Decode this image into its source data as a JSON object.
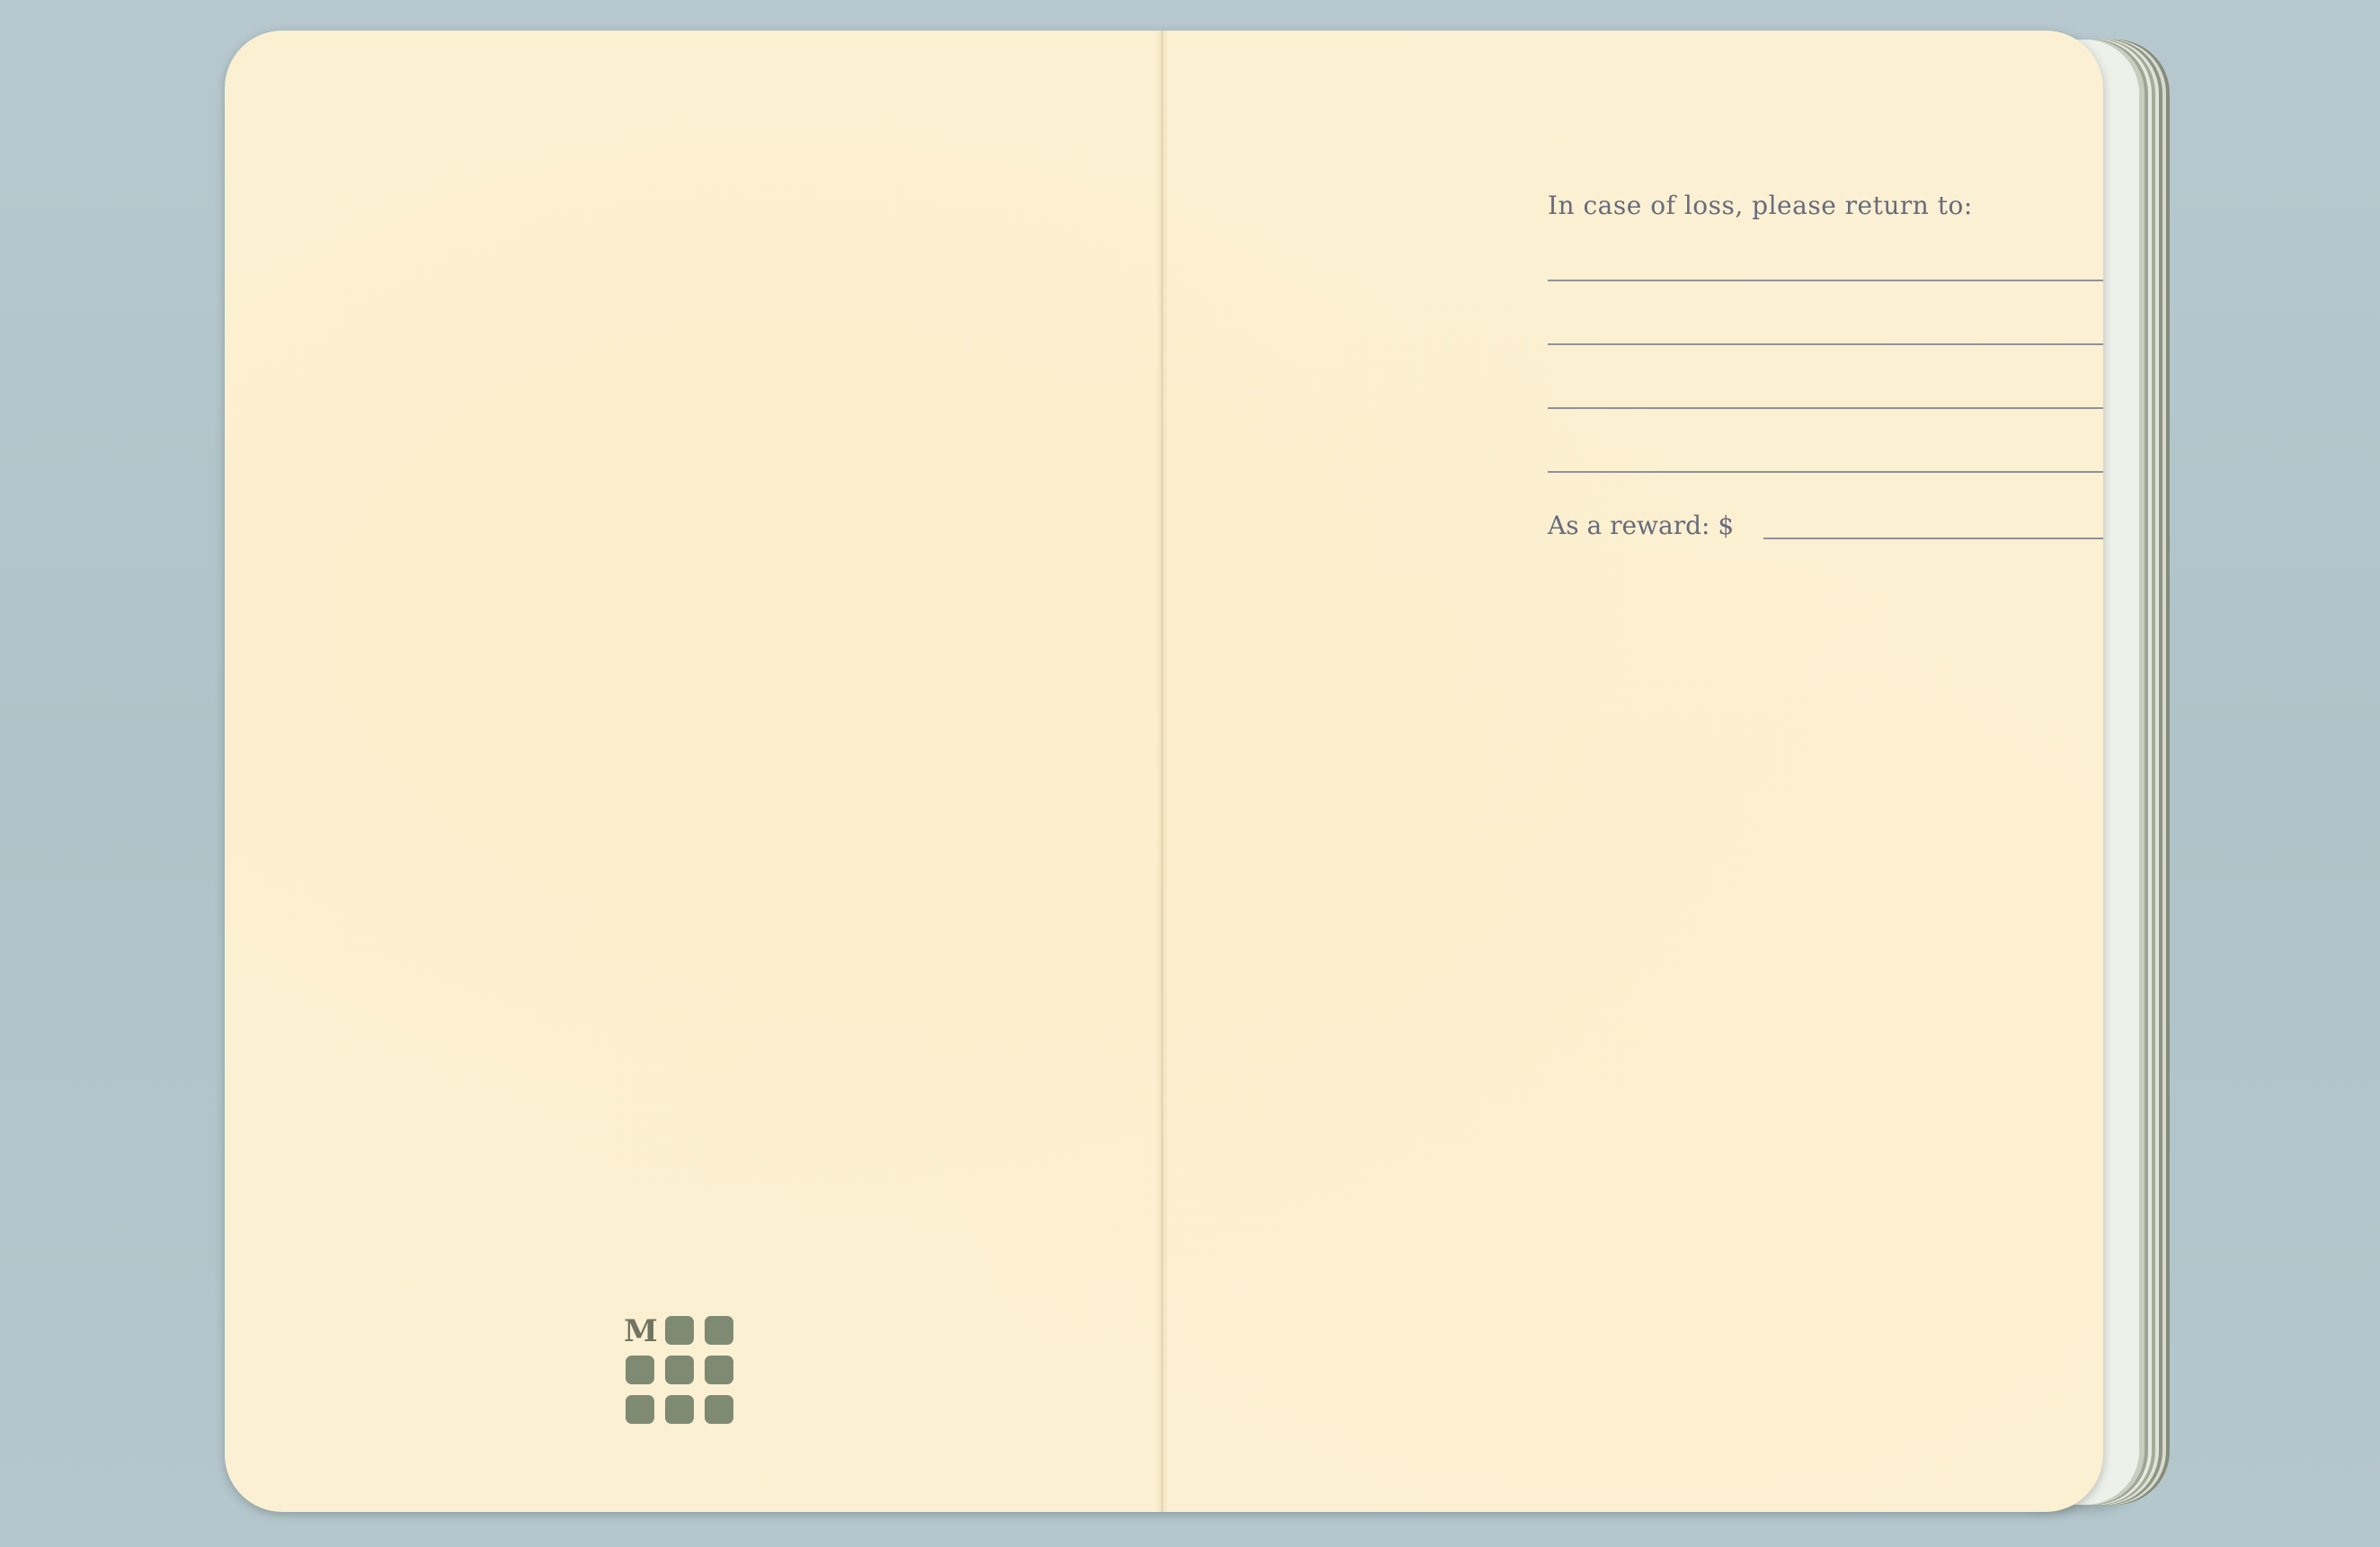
{
  "notebook": {
    "right_page": {
      "return_title": "In case of loss, please return to:",
      "address_lines": 4,
      "reward_label": "As a reward: $"
    },
    "left_page": {
      "logo_letter": "M",
      "logo_icon": "grid-of-squares-logo"
    }
  },
  "colors": {
    "paper": "#fbf0d3",
    "background": "#b3c6cb",
    "print_text": "#676b7c",
    "logo": "#7f8a72"
  }
}
